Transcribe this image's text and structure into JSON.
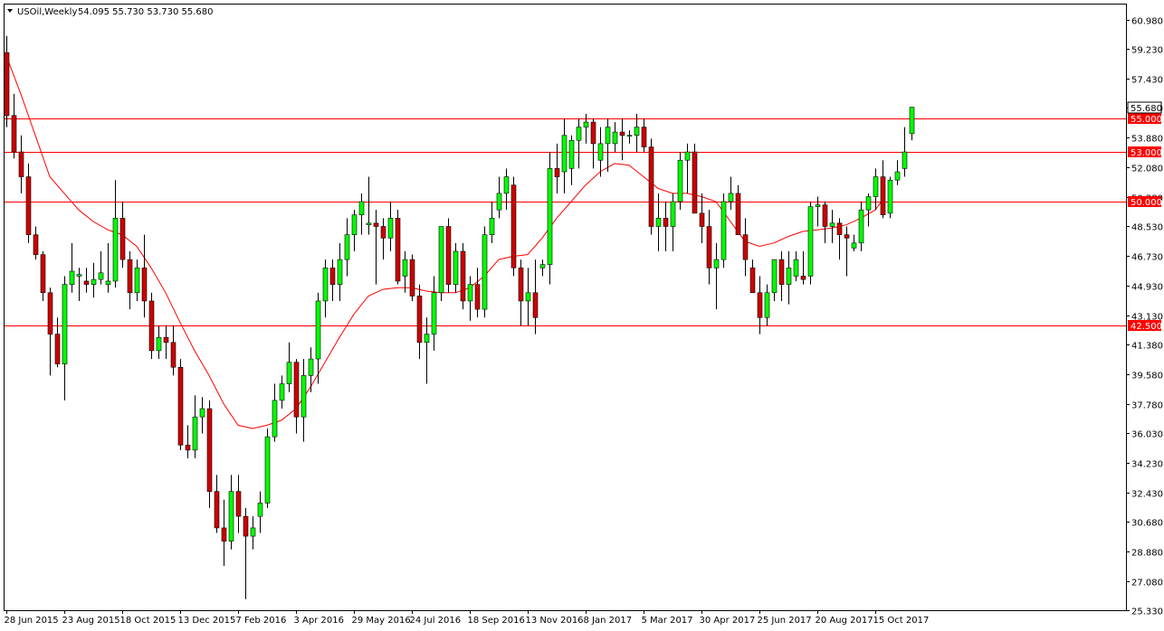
{
  "header": {
    "symbol_line": "USOil,Weekly",
    "ohlc_line": "54.095 55.730 53.730 55.680",
    "menu_icon": "triangle-down-icon"
  },
  "colors": {
    "up": "#00ff00",
    "down": "#cc0000",
    "wick": "#000000",
    "ma": "#ff0000",
    "level": "#ff0000",
    "frame": "#000000",
    "background": "#ffffff"
  },
  "chart_data": {
    "type": "candlestick",
    "title": "USOil,Weekly",
    "timeframe": "Weekly",
    "last_price": "55.680",
    "ylim": [
      25.33,
      61.9
    ],
    "y_ticks": [
      "60.980",
      "59.230",
      "57.430",
      "55.680",
      "53.880",
      "52.080",
      "50.280",
      "48.530",
      "46.730",
      "44.930",
      "43.130",
      "41.380",
      "39.580",
      "37.780",
      "36.030",
      "34.230",
      "32.430",
      "30.680",
      "28.880",
      "27.080",
      "25.330"
    ],
    "x_labels": [
      {
        "index": 0,
        "label": "28 Jun 2015"
      },
      {
        "index": 8,
        "label": "23 Aug 2015"
      },
      {
        "index": 16,
        "label": "18 Oct 2015"
      },
      {
        "index": 24,
        "label": "13 Dec 2015"
      },
      {
        "index": 32,
        "label": "7 Feb 2016"
      },
      {
        "index": 40,
        "label": "3 Apr 2016"
      },
      {
        "index": 48,
        "label": "29 May 2016"
      },
      {
        "index": 56,
        "label": "24 Jul 2016"
      },
      {
        "index": 64,
        "label": "18 Sep 2016"
      },
      {
        "index": 72,
        "label": "13 Nov 2016"
      },
      {
        "index": 80,
        "label": "8 Jan 2017"
      },
      {
        "index": 88,
        "label": "5 Mar 2017"
      },
      {
        "index": 96,
        "label": "30 Apr 2017"
      },
      {
        "index": 104,
        "label": "25 Jun 2017"
      },
      {
        "index": 112,
        "label": "20 Aug 2017"
      },
      {
        "index": 120,
        "label": "15 Oct 2017"
      }
    ],
    "levels": [
      {
        "value": 55.0,
        "label": "55.000"
      },
      {
        "value": 53.0,
        "label": "53.000"
      },
      {
        "value": 50.0,
        "label": "50.000"
      },
      {
        "value": 42.5,
        "label": "42.500"
      }
    ],
    "candles": [
      [
        59.0,
        60.0,
        54.5,
        55.2
      ],
      [
        55.2,
        56.5,
        52.6,
        53.0
      ],
      [
        53.0,
        54.0,
        50.5,
        51.5
      ],
      [
        51.5,
        52.3,
        47.5,
        48.0
      ],
      [
        48.0,
        48.5,
        46.5,
        46.8
      ],
      [
        46.8,
        47.0,
        44.0,
        44.5
      ],
      [
        44.5,
        44.8,
        39.5,
        42.0
      ],
      [
        42.0,
        43.0,
        40.0,
        40.2
      ],
      [
        40.2,
        45.5,
        38.0,
        45.0
      ],
      [
        45.0,
        47.5,
        44.5,
        45.8
      ],
      [
        45.5,
        46.0,
        44.0,
        45.6
      ],
      [
        45.2,
        46.0,
        44.5,
        45.0
      ],
      [
        45.0,
        46.3,
        44.2,
        45.3
      ],
      [
        45.3,
        47.0,
        45.0,
        45.7
      ],
      [
        45.0,
        47.5,
        44.5,
        45.2
      ],
      [
        45.2,
        51.3,
        44.8,
        49.0
      ],
      [
        49.0,
        50.0,
        46.0,
        46.5
      ],
      [
        46.5,
        47.0,
        43.5,
        44.5
      ],
      [
        44.5,
        46.5,
        44.0,
        46.0
      ],
      [
        46.0,
        48.0,
        43.0,
        44.0
      ],
      [
        44.0,
        44.5,
        40.5,
        41.0
      ],
      [
        41.0,
        42.5,
        40.5,
        41.8
      ],
      [
        41.8,
        42.5,
        40.5,
        41.5
      ],
      [
        41.5,
        42.5,
        39.5,
        40.0
      ],
      [
        40.0,
        40.5,
        35.0,
        35.3
      ],
      [
        35.3,
        36.5,
        34.5,
        35.0
      ],
      [
        35.0,
        38.3,
        34.5,
        37.0
      ],
      [
        37.0,
        38.2,
        36.0,
        37.5
      ],
      [
        37.5,
        38.0,
        31.5,
        32.5
      ],
      [
        32.5,
        33.5,
        30.0,
        30.3
      ],
      [
        30.3,
        32.0,
        28.0,
        29.5
      ],
      [
        29.5,
        33.5,
        29.0,
        32.5
      ],
      [
        32.5,
        33.5,
        30.0,
        31.0
      ],
      [
        31.0,
        31.5,
        26.0,
        29.8
      ],
      [
        29.8,
        31.0,
        29.0,
        30.3
      ],
      [
        31.0,
        32.5,
        30.0,
        31.8
      ],
      [
        31.8,
        36.3,
        31.5,
        35.8
      ],
      [
        35.8,
        39.0,
        35.5,
        38.0
      ],
      [
        38.0,
        39.5,
        37.5,
        39.0
      ],
      [
        39.0,
        41.5,
        38.5,
        40.3
      ],
      [
        40.3,
        40.5,
        36.0,
        37.0
      ],
      [
        37.0,
        40.5,
        35.5,
        39.5
      ],
      [
        39.5,
        41.2,
        38.5,
        40.5
      ],
      [
        40.5,
        44.5,
        39.0,
        44.0
      ],
      [
        44.0,
        46.5,
        43.0,
        46.0
      ],
      [
        46.0,
        46.5,
        44.0,
        45.0
      ],
      [
        45.0,
        47.5,
        44.0,
        46.5
      ],
      [
        46.5,
        49.0,
        45.5,
        48.0
      ],
      [
        48.0,
        49.5,
        47.0,
        49.2
      ],
      [
        49.2,
        50.5,
        48.0,
        50.0
      ],
      [
        48.6,
        51.5,
        48.0,
        48.7
      ],
      [
        48.7,
        49.5,
        45.0,
        48.5
      ],
      [
        48.5,
        49.0,
        46.5,
        47.8
      ],
      [
        47.8,
        50.0,
        47.0,
        49.0
      ],
      [
        49.0,
        49.5,
        45.0,
        45.2
      ],
      [
        45.5,
        47.0,
        44.5,
        46.5
      ],
      [
        46.5,
        46.8,
        44.0,
        44.3
      ],
      [
        44.3,
        45.0,
        40.5,
        41.5
      ],
      [
        41.5,
        43.0,
        39.0,
        42.0
      ],
      [
        42.0,
        45.5,
        41.0,
        44.5
      ],
      [
        44.5,
        48.5,
        44.0,
        48.5
      ],
      [
        48.5,
        49.0,
        44.5,
        45.0
      ],
      [
        45.0,
        47.5,
        44.5,
        47.0
      ],
      [
        47.0,
        47.5,
        43.5,
        44.0
      ],
      [
        44.0,
        45.5,
        42.8,
        45.0
      ],
      [
        45.0,
        46.0,
        43.0,
        43.5
      ],
      [
        43.5,
        48.5,
        43.0,
        48.0
      ],
      [
        48.0,
        50.0,
        47.5,
        49.0
      ],
      [
        49.5,
        51.5,
        49.0,
        50.5
      ],
      [
        50.5,
        52.0,
        49.5,
        51.5
      ],
      [
        51.0,
        51.5,
        45.5,
        46.0
      ],
      [
        46.0,
        46.5,
        42.5,
        44.0
      ],
      [
        44.0,
        46.0,
        42.5,
        44.5
      ],
      [
        44.5,
        46.5,
        42.0,
        43.0
      ],
      [
        46.0,
        46.5,
        45.5,
        46.2
      ],
      [
        46.2,
        53.0,
        45.0,
        52.0
      ],
      [
        52.0,
        53.5,
        50.5,
        51.5
      ],
      [
        51.8,
        55.0,
        50.5,
        54.0
      ],
      [
        52.0,
        54.0,
        51.0,
        53.7
      ],
      [
        53.7,
        55.0,
        52.0,
        54.5
      ],
      [
        54.5,
        55.3,
        53.5,
        54.8
      ],
      [
        54.8,
        55.0,
        52.0,
        53.5
      ],
      [
        52.5,
        54.5,
        51.5,
        53.5
      ],
      [
        53.5,
        55.0,
        51.8,
        54.5
      ],
      [
        53.5,
        54.8,
        53.0,
        54.2
      ],
      [
        54.2,
        55.0,
        52.5,
        54.0
      ],
      [
        54.0,
        54.3,
        53.5,
        54.0
      ],
      [
        54.0,
        55.3,
        53.0,
        54.5
      ],
      [
        54.5,
        55.0,
        53.0,
        53.3
      ],
      [
        53.3,
        53.8,
        48.0,
        48.5
      ],
      [
        48.5,
        50.5,
        47.0,
        49.0
      ],
      [
        49.0,
        50.0,
        47.0,
        48.5
      ],
      [
        48.5,
        50.5,
        47.0,
        50.0
      ],
      [
        50.0,
        53.0,
        49.5,
        52.5
      ],
      [
        52.5,
        53.5,
        50.5,
        53.0
      ],
      [
        53.0,
        53.5,
        49.5,
        49.3
      ],
      [
        49.3,
        50.5,
        47.5,
        48.5
      ],
      [
        48.5,
        49.5,
        45.0,
        46.0
      ],
      [
        46.0,
        47.5,
        43.5,
        46.5
      ],
      [
        46.5,
        50.5,
        46.0,
        50.0
      ],
      [
        50.0,
        51.5,
        49.5,
        50.5
      ],
      [
        50.5,
        51.0,
        48.0,
        48.0
      ],
      [
        48.0,
        49.0,
        45.5,
        46.5
      ],
      [
        46.0,
        46.5,
        44.5,
        44.5
      ],
      [
        44.5,
        45.5,
        42.0,
        43.0
      ],
      [
        43.0,
        45.0,
        42.5,
        44.5
      ],
      [
        44.5,
        46.0,
        44.0,
        46.5
      ],
      [
        46.5,
        47.0,
        44.0,
        45.0
      ],
      [
        45.0,
        47.0,
        43.8,
        46.0
      ],
      [
        45.5,
        47.0,
        45.2,
        46.5
      ],
      [
        45.5,
        47.0,
        45.0,
        45.3
      ],
      [
        45.5,
        50.0,
        45.0,
        49.7
      ],
      [
        49.7,
        50.3,
        48.5,
        49.8
      ],
      [
        49.8,
        50.0,
        47.5,
        48.5
      ],
      [
        48.5,
        49.5,
        47.5,
        48.7
      ],
      [
        48.7,
        49.0,
        46.5,
        48.0
      ],
      [
        48.0,
        48.5,
        45.5,
        47.8
      ],
      [
        47.2,
        48.0,
        47.0,
        47.5
      ],
      [
        47.5,
        50.0,
        47.0,
        49.5
      ],
      [
        49.5,
        50.5,
        48.5,
        50.3
      ],
      [
        50.3,
        52.0,
        49.5,
        51.5
      ],
      [
        51.5,
        52.5,
        49.0,
        49.2
      ],
      [
        49.3,
        51.5,
        49.0,
        51.3
      ],
      [
        51.3,
        52.5,
        51.0,
        51.8
      ],
      [
        52.0,
        54.5,
        51.5,
        53.0
      ],
      [
        54.1,
        55.7,
        53.7,
        55.7
      ]
    ],
    "moving_average": [
      [
        0,
        58.8
      ],
      [
        2,
        56.5
      ],
      [
        4,
        54.0
      ],
      [
        6,
        51.5
      ],
      [
        8,
        50.5
      ],
      [
        10,
        49.5
      ],
      [
        12,
        48.8
      ],
      [
        14,
        48.3
      ],
      [
        16,
        48.0
      ],
      [
        18,
        47.3
      ],
      [
        20,
        46.0
      ],
      [
        22,
        44.5
      ],
      [
        24,
        42.7
      ],
      [
        26,
        41.0
      ],
      [
        28,
        39.5
      ],
      [
        30,
        37.8
      ],
      [
        32,
        36.5
      ],
      [
        34,
        36.3
      ],
      [
        36,
        36.5
      ],
      [
        38,
        36.8
      ],
      [
        40,
        37.5
      ],
      [
        42,
        38.8
      ],
      [
        44,
        40.3
      ],
      [
        46,
        41.8
      ],
      [
        48,
        43.2
      ],
      [
        50,
        44.3
      ],
      [
        52,
        44.7
      ],
      [
        54,
        44.8
      ],
      [
        56,
        44.8
      ],
      [
        58,
        44.6
      ],
      [
        60,
        44.5
      ],
      [
        62,
        44.5
      ],
      [
        64,
        44.8
      ],
      [
        66,
        45.5
      ],
      [
        68,
        46.5
      ],
      [
        70,
        46.7
      ],
      [
        72,
        46.8
      ],
      [
        74,
        47.8
      ],
      [
        76,
        49.0
      ],
      [
        78,
        50.0
      ],
      [
        80,
        51.0
      ],
      [
        82,
        51.8
      ],
      [
        84,
        52.3
      ],
      [
        86,
        52.2
      ],
      [
        88,
        51.5
      ],
      [
        90,
        50.8
      ],
      [
        92,
        50.5
      ],
      [
        94,
        50.5
      ],
      [
        96,
        50.3
      ],
      [
        98,
        50.0
      ],
      [
        100,
        48.8
      ],
      [
        102,
        47.6
      ],
      [
        104,
        47.3
      ],
      [
        106,
        47.5
      ],
      [
        108,
        47.9
      ],
      [
        110,
        48.2
      ],
      [
        112,
        48.3
      ],
      [
        114,
        48.4
      ],
      [
        116,
        48.6
      ],
      [
        118,
        49.0
      ],
      [
        120,
        49.5
      ],
      [
        121,
        50.1
      ]
    ]
  }
}
